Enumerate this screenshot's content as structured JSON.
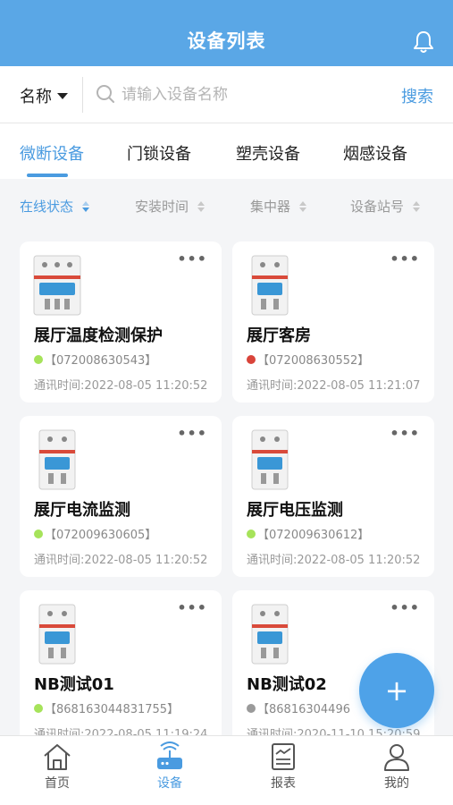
{
  "header": {
    "title": "设备列表",
    "bell_icon": "bell-icon"
  },
  "search": {
    "filter_label": "名称",
    "placeholder": "请输入设备名称",
    "button_label": "搜索"
  },
  "tabs": [
    {
      "label": "微断设备",
      "active": true
    },
    {
      "label": "门锁设备",
      "active": false
    },
    {
      "label": "塑壳设备",
      "active": false
    },
    {
      "label": "烟感设备",
      "active": false
    }
  ],
  "sort": [
    {
      "label": "在线状态",
      "active": true
    },
    {
      "label": "安装时间",
      "active": false
    },
    {
      "label": "集中器",
      "active": false
    },
    {
      "label": "设备站号",
      "active": false
    }
  ],
  "devices": [
    {
      "name": "展厅温度检测保护",
      "id": "【072008630543】",
      "status_color": "#a6e35a",
      "time": "通讯时间:2022-08-05 11:20:52"
    },
    {
      "name": "展厅客房",
      "id": "【072008630552】",
      "status_color": "#d9443a",
      "time": "通讯时间:2022-08-05 11:21:07"
    },
    {
      "name": "展厅电流监测",
      "id": "【072009630605】",
      "status_color": "#a6e35a",
      "time": "通讯时间:2022-08-05 11:20:52"
    },
    {
      "name": "展厅电压监测",
      "id": "【072009630612】",
      "status_color": "#a6e35a",
      "time": "通讯时间:2022-08-05 11:20:52"
    },
    {
      "name": "NB测试01",
      "id": "【868163044831755】",
      "status_color": "#a6e35a",
      "time": "通讯时间:2022-08-05 11:19:24"
    },
    {
      "name": "NB测试02",
      "id": "【86816304496",
      "status_color": "#9a9a9a",
      "time": "通讯时间:2020-11-10 15:20:59"
    }
  ],
  "more_glyph": "•••",
  "fab": {
    "label": "+"
  },
  "nav": [
    {
      "label": "首页",
      "icon": "home-icon",
      "active": false
    },
    {
      "label": "设备",
      "icon": "router-icon",
      "active": true
    },
    {
      "label": "报表",
      "icon": "report-icon",
      "active": false
    },
    {
      "label": "我的",
      "icon": "user-icon",
      "active": false
    }
  ],
  "colors": {
    "accent": "#4a9be0",
    "header": "#5aa7e6",
    "online": "#a6e35a",
    "fault": "#d9443a",
    "offline": "#9a9a9a"
  }
}
